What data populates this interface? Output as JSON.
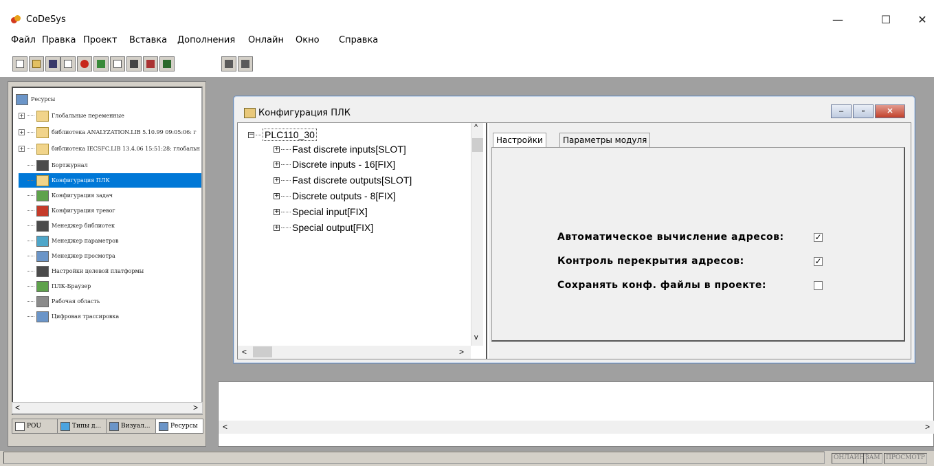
{
  "window": {
    "title": "CoDeSys",
    "min_glyph": "—",
    "max_glyph": "☐",
    "close_glyph": "✕"
  },
  "menu": [
    "Файл",
    "Правка",
    "Проект",
    "Вставка",
    "Дополнения",
    "Онлайн",
    "Окно",
    "Справка"
  ],
  "left_tree": {
    "root": "Ресурсы",
    "items": [
      {
        "label": "Глобальные переменные",
        "icon": "folder-icon"
      },
      {
        "label": "библиотека ANALYZATION.LIB 5.10.99 09:05:06: г",
        "icon": "folder-icon"
      },
      {
        "label": "библиотека IECSFC.LIB 13.4.06 15:51:28: глобальн",
        "icon": "folder-icon"
      },
      {
        "label": "Бортжурнал",
        "icon": "logbook-icon"
      },
      {
        "label": "Конфигурация ПЛК",
        "icon": "plc-config-icon",
        "selected": true
      },
      {
        "label": "Конфигурация задач",
        "icon": "task-config-icon"
      },
      {
        "label": "Конфигурация тревог",
        "icon": "alarm-config-icon"
      },
      {
        "label": "Менеджер библиотек",
        "icon": "library-manager-icon"
      },
      {
        "label": "Менеджер параметров",
        "icon": "parameter-manager-icon"
      },
      {
        "label": "Менеджер просмотра",
        "icon": "watch-manager-icon"
      },
      {
        "label": "Настройки целевой платформы",
        "icon": "target-settings-icon"
      },
      {
        "label": "ПЛК-Браузер",
        "icon": "plc-browser-icon"
      },
      {
        "label": "Рабочая область",
        "icon": "workspace-icon"
      },
      {
        "label": "Цифровая трассировка",
        "icon": "trace-icon"
      }
    ]
  },
  "bottom_tabs": [
    "POU",
    "Типы д...",
    "Визуал...",
    "Ресурсы"
  ],
  "child": {
    "title": "Конфигурация ПЛК",
    "tree_root": "PLC110_30",
    "tree_items": [
      "Fast discrete inputs[SLOT]",
      "Discrete inputs - 16[FIX]",
      "Fast discrete outputs[SLOT]",
      "Discrete outputs - 8[FIX]",
      "Special input[FIX]",
      "Special output[FIX]"
    ],
    "tabs": [
      "Настройки",
      "Параметры модуля"
    ],
    "options": [
      {
        "label": "Автоматическое вычисление адресов:",
        "checked": true
      },
      {
        "label": "Контроль перекрытия адресов:",
        "checked": true
      },
      {
        "label": "Сохранять конф. файлы в проекте:",
        "checked": false
      }
    ]
  },
  "status": [
    "ОНЛАЙН",
    "ЗАМ",
    "ПРОСМОТР"
  ]
}
